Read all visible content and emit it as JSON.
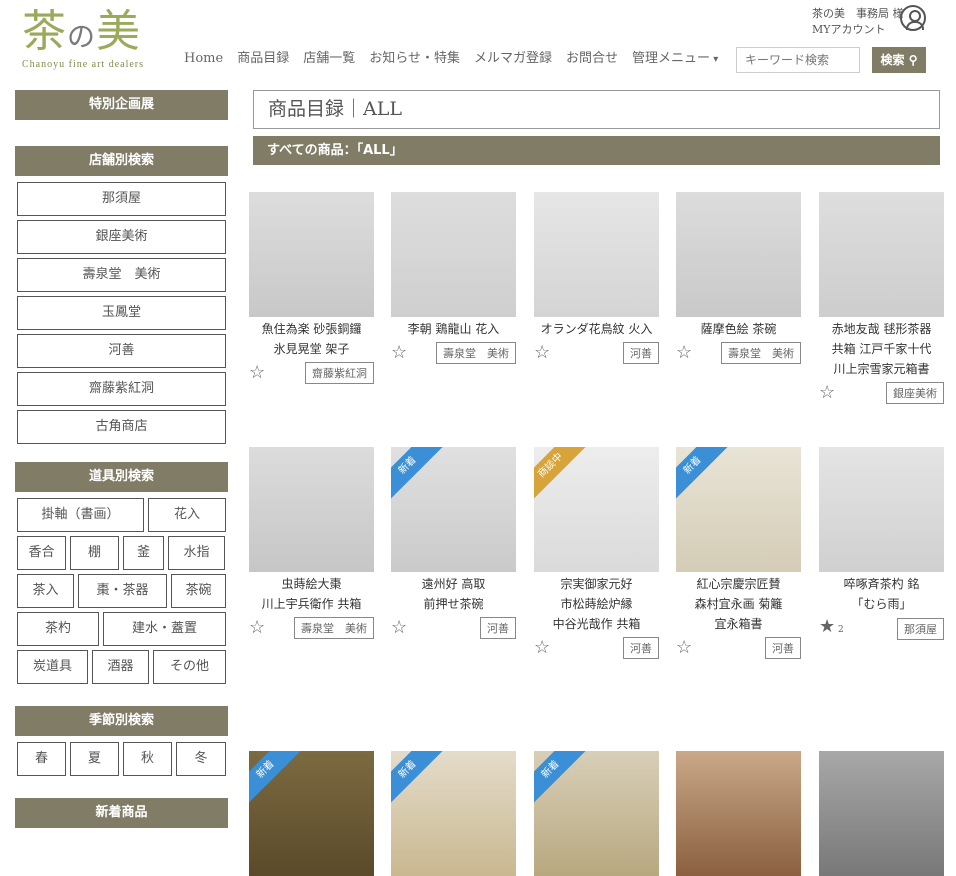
{
  "header": {
    "logo_main_a": "茶",
    "logo_main_no": "の",
    "logo_main_b": "美",
    "logo_sub": "Chanoyu fine art dealers",
    "account_line1": "茶の美　事務局 様",
    "account_line2": "MYアカウント",
    "nav": [
      "Home",
      "商品目録",
      "店舗一覧",
      "お知らせ・特集",
      "メルマガ登録",
      "お問合せ",
      "管理メニュー"
    ],
    "search_placeholder": "キーワード検索",
    "search_label": "検索"
  },
  "sidebar": {
    "special": "特別企画展",
    "shops_head": "店舗別検索",
    "shops": [
      "那須屋",
      "銀座美術",
      "壽泉堂　美術",
      "玉鳳堂",
      "河善",
      "齋藤紫紅洞",
      "古角商店"
    ],
    "tools_head": "道具別検索",
    "tools": [
      "掛軸（書画）",
      "花入",
      "香合",
      "棚",
      "釜",
      "水指",
      "茶入",
      "棗・茶器",
      "茶碗",
      "茶杓",
      "建水・蓋置",
      "炭道具",
      "酒器",
      "その他"
    ],
    "season_head": "季節別検索",
    "seasons": [
      "春",
      "夏",
      "秋",
      "冬"
    ],
    "new_head": "新着商品"
  },
  "main": {
    "title": "商品目録｜ALL",
    "subtitle": "すべての商品：「ALL」"
  },
  "products": [
    {
      "caption": [
        "魚住為楽 砂張銅鑼",
        "氷見晃堂 架子"
      ],
      "shop": "齋藤紫紅洞",
      "ribbon": ""
    },
    {
      "caption": [
        "李朝 鶏龍山 花入"
      ],
      "shop": "壽泉堂　美術",
      "ribbon": ""
    },
    {
      "caption": [
        "オランダ花鳥紋 火入"
      ],
      "shop": "河善",
      "ribbon": ""
    },
    {
      "caption": [
        "薩摩色絵 茶碗"
      ],
      "shop": "壽泉堂　美術",
      "ribbon": ""
    },
    {
      "caption": [
        "赤地友哉 毬形茶器",
        "共箱 江戸千家十代",
        "川上宗雪家元箱書"
      ],
      "shop": "銀座美術",
      "ribbon": ""
    },
    {
      "caption": [
        "虫蒔絵大棗",
        "川上宇兵衛作 共箱"
      ],
      "shop": "壽泉堂　美術",
      "ribbon": ""
    },
    {
      "caption": [
        "遠州好 高取",
        "前押せ茶碗"
      ],
      "shop": "河善",
      "ribbon": "新着"
    },
    {
      "caption": [
        "宗実御家元好",
        "市松蒔絵炉縁",
        "中谷光哉作 共箱"
      ],
      "shop": "河善",
      "ribbon": "商談中"
    },
    {
      "caption": [
        "紅心宗慶宗匠賛",
        "森村宜永画 菊籬",
        "宜永箱書"
      ],
      "shop": "河善",
      "ribbon": "新着"
    },
    {
      "caption": [
        "啐啄斉茶杓 銘",
        "「むら雨」"
      ],
      "shop": "那須屋",
      "ribbon": "",
      "fav_count": "2"
    },
    {
      "caption": [],
      "shop": "",
      "ribbon": "新着"
    },
    {
      "caption": [],
      "shop": "",
      "ribbon": "新着"
    },
    {
      "caption": [],
      "shop": "",
      "ribbon": "新着"
    },
    {
      "caption": [],
      "shop": "",
      "ribbon": ""
    },
    {
      "caption": [],
      "shop": "",
      "ribbon": ""
    }
  ],
  "colors": {
    "accent": "#807c66",
    "logo_green": "#9aaa5a",
    "new_ribbon": "#3a8fd6",
    "deal_ribbon": "#d8a43a"
  }
}
